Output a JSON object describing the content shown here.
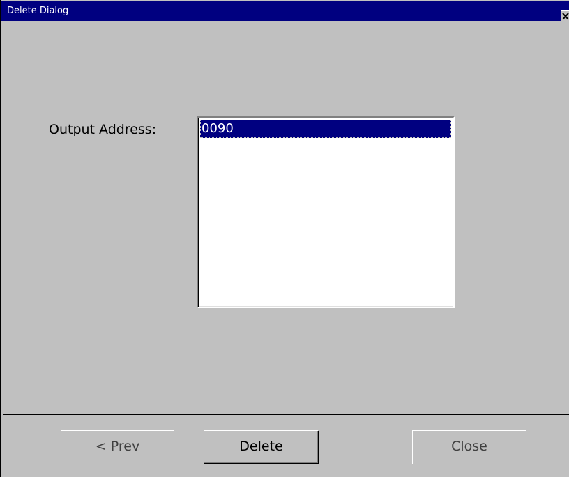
{
  "window": {
    "title": "Delete Dialog",
    "close_icon": "close-icon"
  },
  "form": {
    "output_address_label": "Output Address:",
    "output_address_items": [
      "0090"
    ],
    "selected_item": "0090"
  },
  "buttons": {
    "prev_label": "< Prev",
    "delete_label": "Delete",
    "close_label": "Close"
  },
  "colors": {
    "titlebar": "#000080",
    "face": "#c0c0c0",
    "selection": "#000080"
  }
}
